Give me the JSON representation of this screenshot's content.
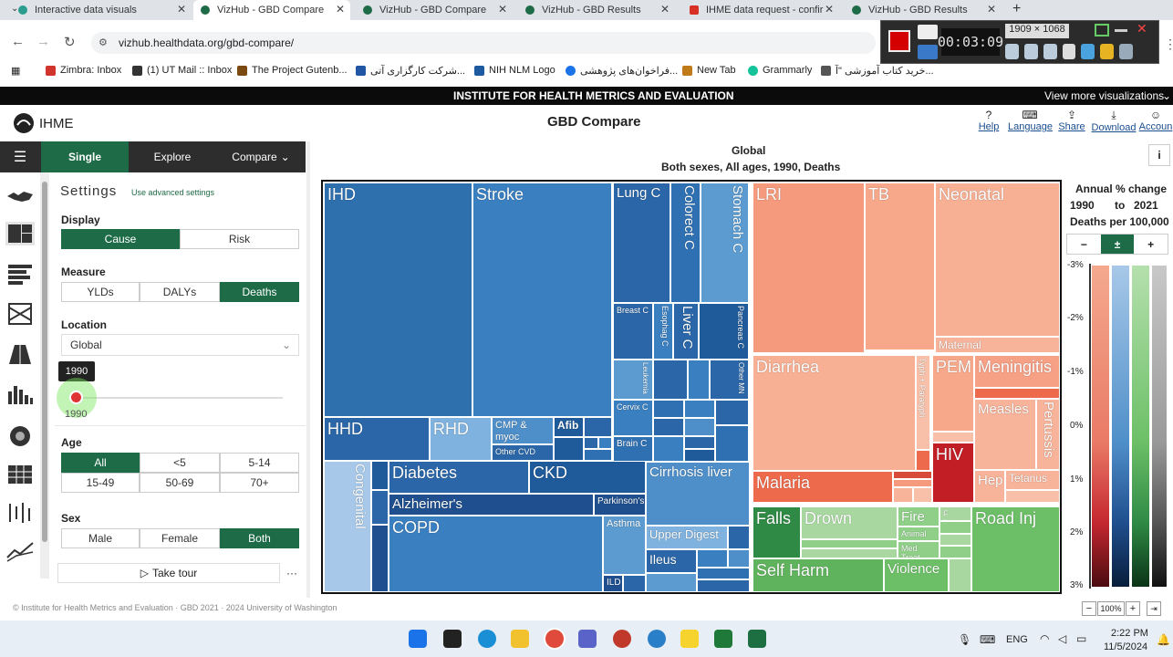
{
  "browser": {
    "tabs": [
      {
        "title": "Interactive data visuals"
      },
      {
        "title": "VizHub - GBD Compare"
      },
      {
        "title": "VizHub - GBD Compare"
      },
      {
        "title": "VizHub - GBD Results"
      },
      {
        "title": "IHME data request - confir"
      },
      {
        "title": "VizHub - GBD Results"
      }
    ],
    "url": "vizhub.healthdata.org/gbd-compare/",
    "bookmarks": [
      {
        "label": "Zimbra: Inbox"
      },
      {
        "label": "(1) UT Mail :: Inbox"
      },
      {
        "label": "The Project Gutenb..."
      },
      {
        "label": "شرکت کارگزاری آتی..."
      },
      {
        "label": "NIH NLM Logo"
      },
      {
        "label": "فراخوان‌های پژوهشی..."
      },
      {
        "label": "New Tab"
      },
      {
        "label": "Grammarly"
      },
      {
        "label": "خرید کتاب آموزشی \"آ..."
      }
    ]
  },
  "recorder": {
    "time": "00:03:09",
    "size": "1909 × 1068"
  },
  "topbar": {
    "title": "INSTITUTE FOR HEALTH METRICS AND EVALUATION",
    "more": "View more visualizations"
  },
  "header": {
    "logo": "IHME",
    "title": "GBD Compare",
    "actions": [
      {
        "label": "Help"
      },
      {
        "label": "Language"
      },
      {
        "label": "Share"
      },
      {
        "label": "Download"
      },
      {
        "label": "Accoun"
      }
    ]
  },
  "nav": {
    "single": "Single",
    "explore": "Explore",
    "compare": "Compare"
  },
  "settings": {
    "title": "Settings",
    "advanced": "Use advanced settings",
    "display_label": "Display",
    "display": [
      "Cause",
      "Risk"
    ],
    "measure_label": "Measure",
    "measure": [
      "YLDs",
      "DALYs",
      "Deaths"
    ],
    "location_label": "Location",
    "location": "Global",
    "year_tooltip": "1990",
    "year_value": "1990",
    "age_label": "Age",
    "ages": [
      "All",
      "<5",
      "5-14",
      "15-49",
      "50-69",
      "70+"
    ],
    "sex_label": "Sex",
    "sex": [
      "Male",
      "Female",
      "Both"
    ],
    "tour": "Take tour",
    "more": "···"
  },
  "chart": {
    "title": "Global",
    "subtitle": "Both sexes, All ages, 1990, Deaths",
    "info": "i"
  },
  "treemap": {
    "cells": [
      {
        "label": "IHD",
        "color": "#2e6fae"
      },
      {
        "label": "Stroke",
        "color": "#3a7fc0"
      },
      {
        "label": "Lung C",
        "color": "#2a66a8"
      },
      {
        "label": "Colorect C",
        "color": "#2f70b2"
      },
      {
        "label": "Stomach C",
        "color": "#5b9bd0"
      },
      {
        "label": "Breast C",
        "color": "#2a66a8"
      },
      {
        "label": "Esophag C",
        "color": "#3a7fc0"
      },
      {
        "label": "Liver C",
        "color": "#2a66a8"
      },
      {
        "label": "Pancreas C",
        "color": "#1f5a9a"
      },
      {
        "label": "Leukemia",
        "color": "#5b9bd0"
      },
      {
        "label": "Other MN",
        "color": "#2a66a8"
      },
      {
        "label": "Cervix C",
        "color": "#3a7fc0"
      },
      {
        "label": "Brain C",
        "color": "#2f70b2"
      },
      {
        "label": "HHD",
        "color": "#2a66a8"
      },
      {
        "label": "RHD",
        "color": "#7fb2de"
      },
      {
        "label": "CMP & myoc",
        "color": "#4f8fc9"
      },
      {
        "label": "Afib",
        "color": "#1f5a9a"
      },
      {
        "label": "Other CVD",
        "color": "#2a66a8"
      },
      {
        "label": "Congenital",
        "color": "#a7c8e8"
      },
      {
        "label": "Diabetes",
        "color": "#2a66a8"
      },
      {
        "label": "CKD",
        "color": "#1f5a9a"
      },
      {
        "label": "Alzheimer's",
        "color": "#1f4f8e"
      },
      {
        "label": "Parkinson's",
        "color": "#1f4f8e"
      },
      {
        "label": "COPD",
        "color": "#3a7fc0"
      },
      {
        "label": "Asthma",
        "color": "#5b9bd0"
      },
      {
        "label": "ILD",
        "color": "#1f4f8e"
      },
      {
        "label": "Cirrhosis liver",
        "color": "#4f8fc9"
      },
      {
        "label": "Upper Digest",
        "color": "#7fb2de"
      },
      {
        "label": "Ileus",
        "color": "#2a66a8"
      },
      {
        "label": "LRI",
        "color": "#f59a7c"
      },
      {
        "label": "TB",
        "color": "#f7a88a"
      },
      {
        "label": "Neonatal",
        "color": "#f8b094"
      },
      {
        "label": "Maternal",
        "color": "#f8b49a"
      },
      {
        "label": "Diarrhea",
        "color": "#f8b094"
      },
      {
        "label": "Typh + Paratyph",
        "color": "#f8c0a8"
      },
      {
        "label": "PEM",
        "color": "#f7a88a"
      },
      {
        "label": "Meningitis",
        "color": "#f6a085"
      },
      {
        "label": "Measles",
        "color": "#f8b49a"
      },
      {
        "label": "Pertussis",
        "color": "#f8b49a"
      },
      {
        "label": "HIV",
        "color": "#c21e26"
      },
      {
        "label": "Hep",
        "color": "#f8b49a"
      },
      {
        "label": "Tetanus",
        "color": "#f8b49a"
      },
      {
        "label": "Malaria",
        "color": "#ee6a4c"
      },
      {
        "label": "Falls",
        "color": "#2f8a45"
      },
      {
        "label": "Drown",
        "color": "#a8d8a0"
      },
      {
        "label": "Fire",
        "color": "#8fcf88"
      },
      {
        "label": "Animal",
        "color": "#8fcf88"
      },
      {
        "label": "Med Treat",
        "color": "#8fcf88"
      },
      {
        "label": "F Body",
        "color": "#a8d8a0"
      },
      {
        "label": "Road Inj",
        "color": "#6cbf67"
      },
      {
        "label": "Self Harm",
        "color": "#5fb35c"
      },
      {
        "label": "Violence",
        "color": "#6cbf67"
      }
    ]
  },
  "legend": {
    "title": "Annual % change",
    "from": "1990",
    "to_word": "to",
    "to": "2021",
    "unit": "Deaths per 100,000",
    "buttons": [
      "−",
      "±",
      "+"
    ],
    "ticks": [
      "-3%",
      "-2%",
      "-1%",
      "0%",
      "1%",
      "2%",
      "3%"
    ],
    "zoom": "100%"
  },
  "footer": {
    "text": "© Institute for Health Metrics and Evaluation · GBD 2021 · 2024 University of Washington"
  },
  "taskbar": {
    "lang": "ENG",
    "time": "2:22 PM",
    "date": "11/5/2024"
  }
}
